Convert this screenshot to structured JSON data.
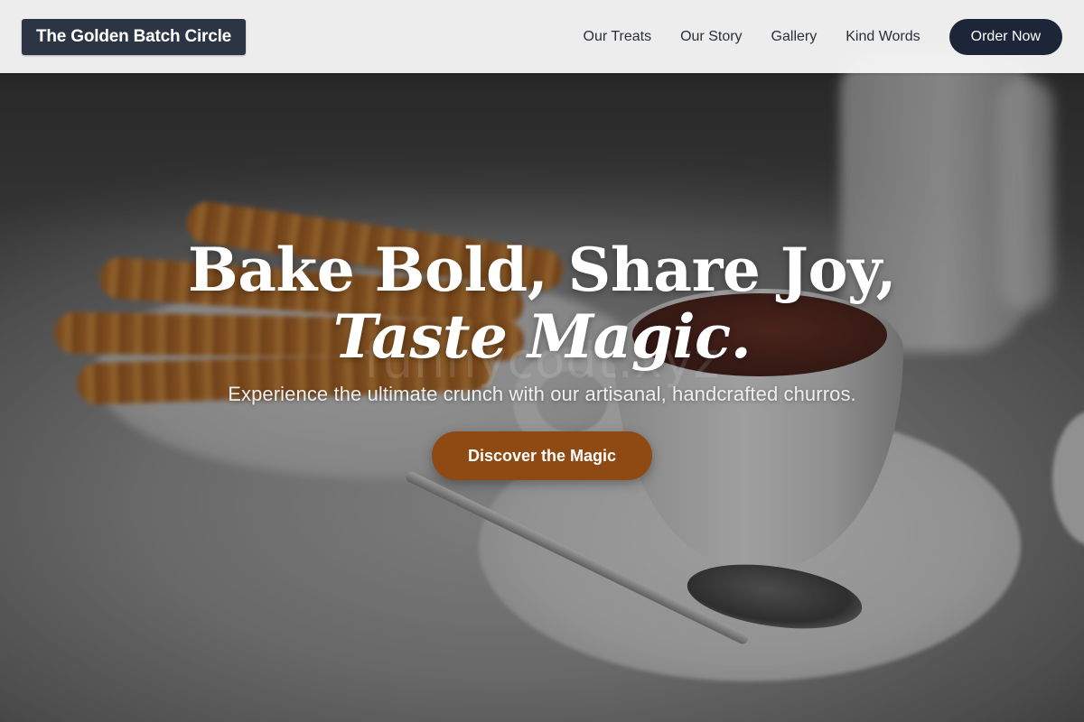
{
  "header": {
    "brand": "The Golden Batch Circle",
    "nav": [
      {
        "label": "Our Treats"
      },
      {
        "label": "Our Story"
      },
      {
        "label": "Gallery"
      },
      {
        "label": "Kind Words"
      }
    ],
    "order_button": "Order Now"
  },
  "hero": {
    "headline_line1": "Bake Bold, Share Joy,",
    "headline_line2": "Taste Magic.",
    "subtext": "Experience the ultimate crunch with our artisanal, handcrafted churros.",
    "cta_label": "Discover the Magic",
    "watermark": "funnycodt.xyz"
  },
  "colors": {
    "brand_bg": "#2c3544",
    "order_button_bg": "#1c2638",
    "cta_bg": "#8f4a14",
    "header_bg": "#f6f6f6"
  }
}
